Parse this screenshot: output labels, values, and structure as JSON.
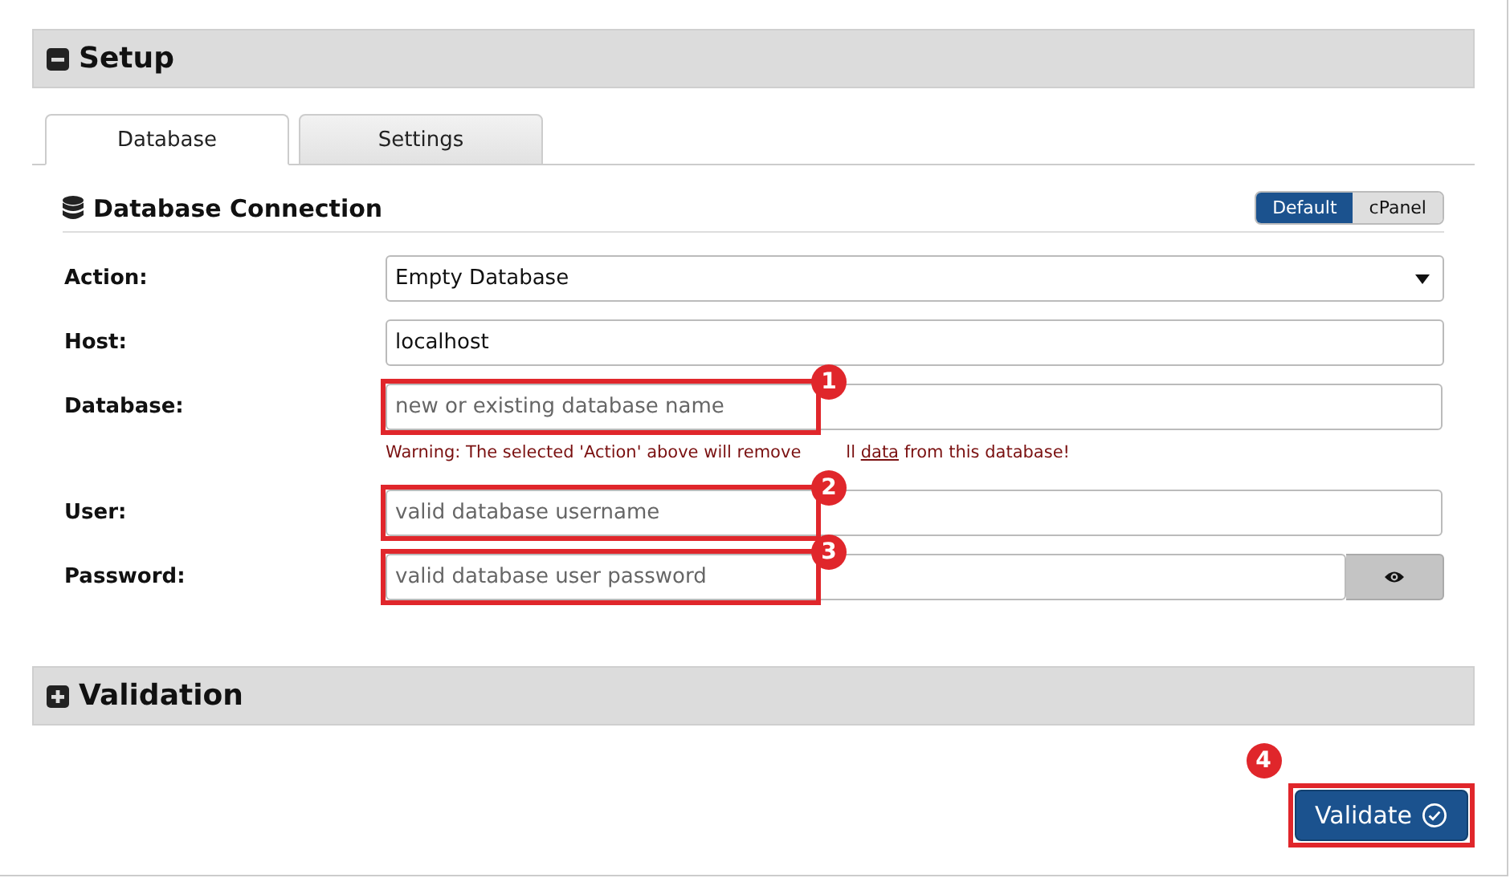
{
  "sections": [
    {
      "title": "Setup",
      "expanded": true,
      "tabs": [
        {
          "label": "Database",
          "selected": true
        },
        {
          "label": "Settings",
          "selected": false
        }
      ],
      "panel": {
        "title": "Database Connection",
        "modes": [
          {
            "label": "Default",
            "selected": true
          },
          {
            "label": "cPanel",
            "selected": false
          }
        ],
        "fields": [
          {
            "kind": "select",
            "label": "Action:",
            "value": "Empty Database"
          },
          {
            "kind": "text",
            "label": "Host:",
            "value": "localhost"
          },
          {
            "kind": "text",
            "label": "Database:",
            "placeholder": "new or existing database name",
            "annotation": "1",
            "warning": {
              "start": "Warning: The selected 'Action' above will remove",
              "end": "ll",
              "link": "data",
              "after": " from this database!"
            }
          },
          {
            "kind": "text",
            "label": "User:",
            "placeholder": "valid database username",
            "annotation": "2"
          },
          {
            "kind": "password",
            "label": "Password:",
            "placeholder": "valid database user password",
            "annotation": "3"
          }
        ]
      }
    },
    {
      "title": "Validation",
      "expanded": false
    }
  ],
  "validate_button": {
    "label": "Validate",
    "annotation": "4"
  }
}
